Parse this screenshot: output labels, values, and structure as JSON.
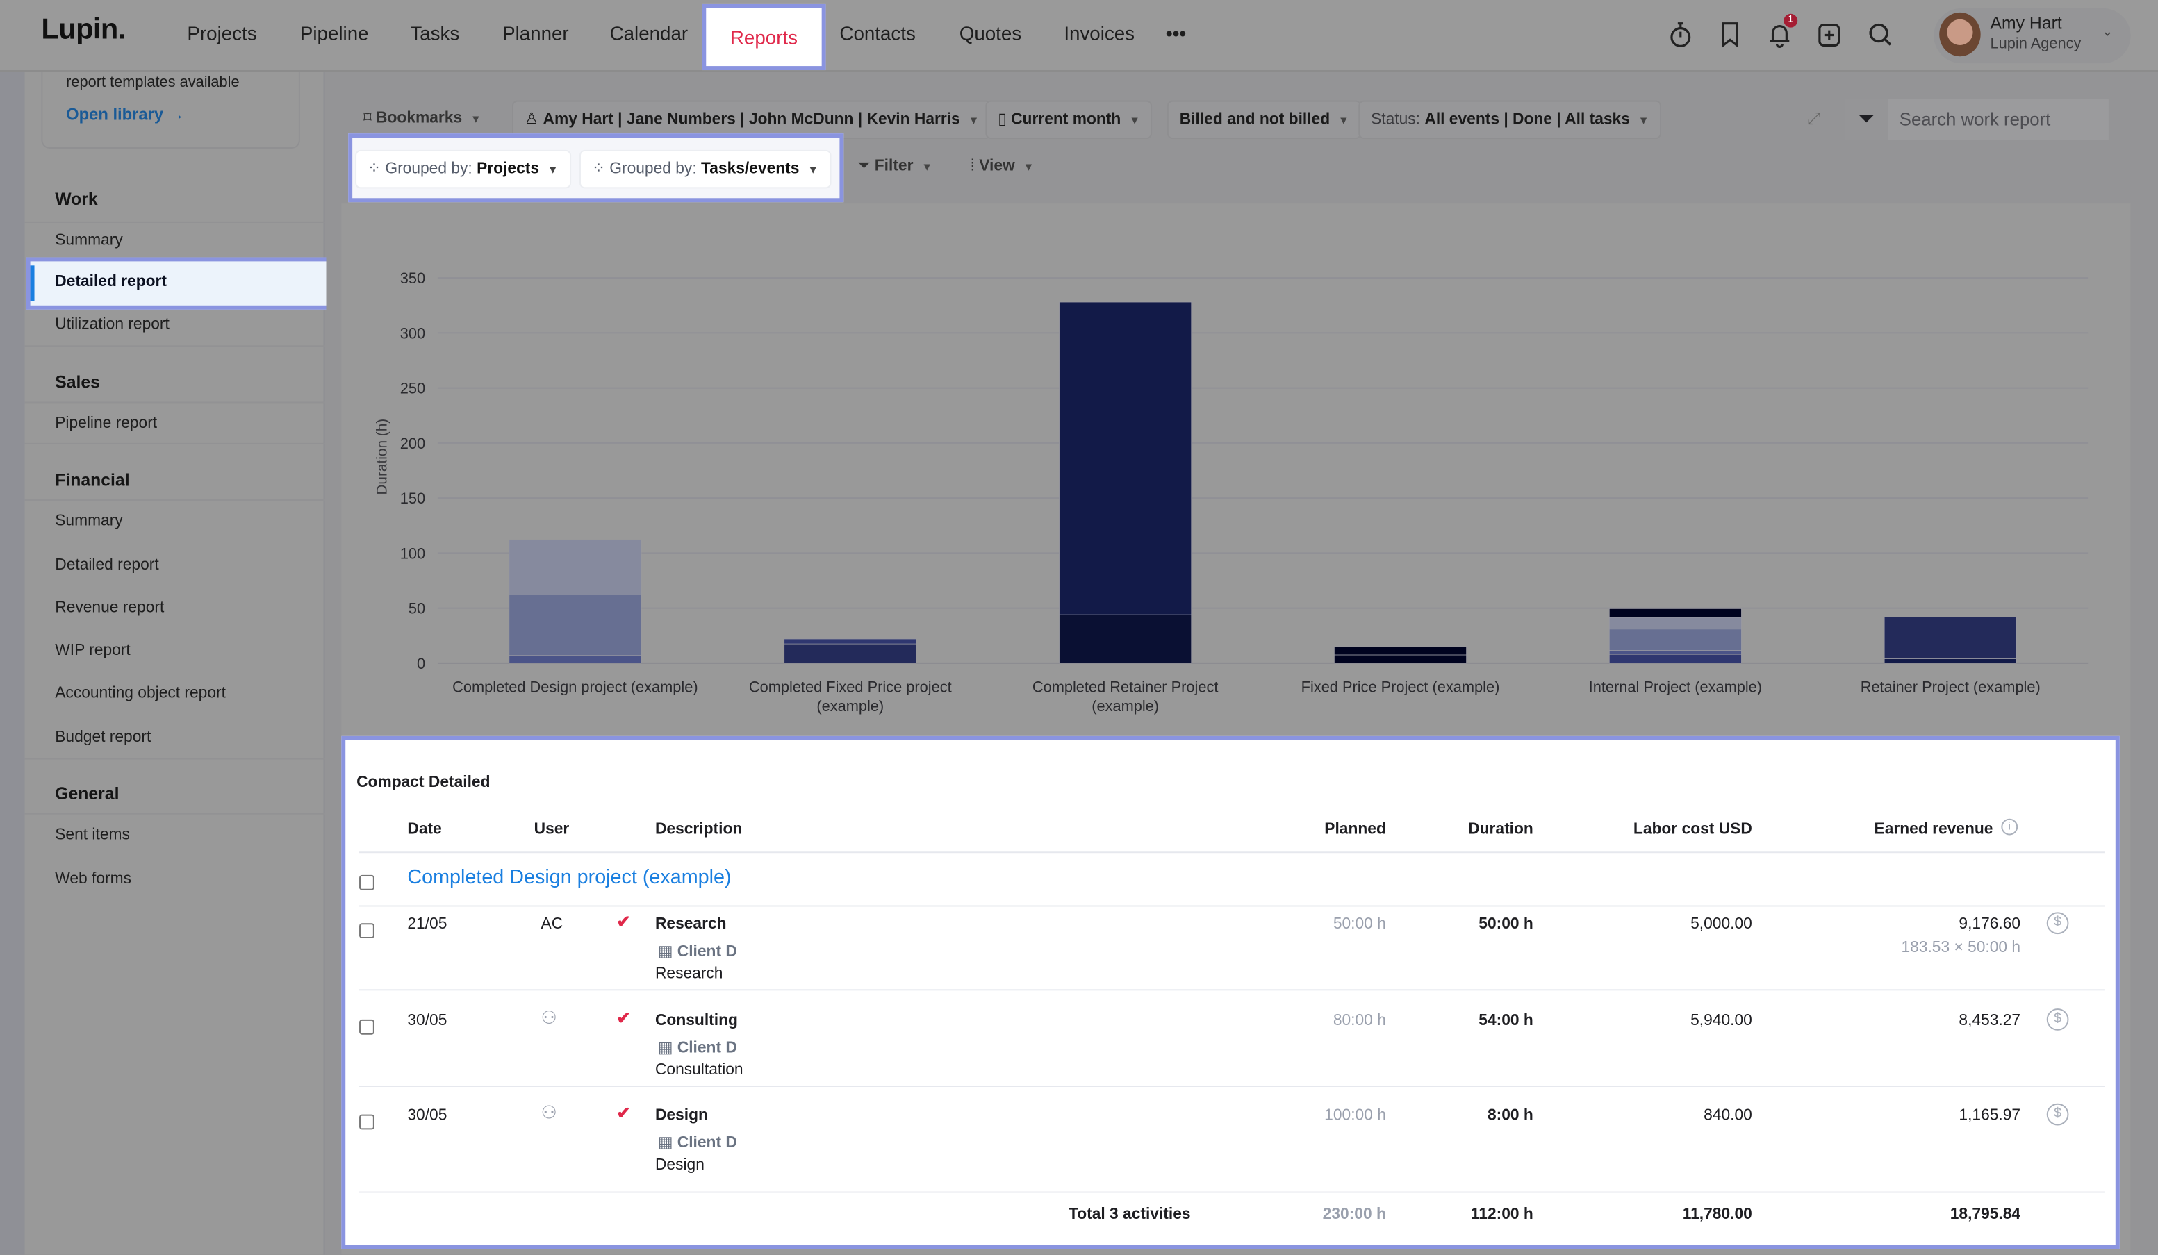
{
  "app": {
    "logo": "Lupin."
  },
  "nav": {
    "items": [
      "Projects",
      "Pipeline",
      "Tasks",
      "Planner",
      "Calendar",
      "Reports",
      "Contacts",
      "Quotes",
      "Invoices"
    ],
    "more": "•••",
    "active": "Reports",
    "notification_count": "1"
  },
  "profile": {
    "name": "Amy Hart",
    "org": "Lupin Agency"
  },
  "sidebar": {
    "library_text": "report templates available",
    "library_link": "Open library →",
    "sections": [
      {
        "title": "Work",
        "items": [
          "Summary",
          "Detailed report",
          "Utilization report"
        ]
      },
      {
        "title": "Sales",
        "items": [
          "Pipeline report"
        ]
      },
      {
        "title": "Financial",
        "items": [
          "Summary",
          "Detailed report",
          "Revenue report",
          "WIP report",
          "Accounting object report",
          "Budget report"
        ]
      },
      {
        "title": "General",
        "items": [
          "Sent items",
          "Web forms"
        ]
      }
    ],
    "active": "Detailed report"
  },
  "filters": {
    "bookmarks": "Bookmarks",
    "users": "Amy Hart | Jane Numbers | John McDunn | Kevin Harris",
    "period": "Current month",
    "billing": "Billed and not billed",
    "status_label": "Status:",
    "status_value": "All events | Done | All tasks",
    "search_placeholder": "Search work report",
    "group1_label": "Grouped by:",
    "group1_value": "Projects",
    "group2_label": "Grouped by:",
    "group2_value": "Tasks/events",
    "filter": "Filter",
    "view": "View"
  },
  "chart_data": {
    "type": "bar",
    "stacked": true,
    "ylabel": "Duration (h)",
    "ylim": [
      0,
      350
    ],
    "yticks": [
      0,
      50,
      100,
      150,
      200,
      250,
      300,
      350
    ],
    "grid": true,
    "categories": [
      "Completed Design project (example)",
      "Completed Fixed Price project (example)",
      "Completed Retainer Project (example)",
      "Fixed Price Project (example)",
      "Internal Project (example)",
      "Retainer Project (example)"
    ],
    "stacks": [
      {
        "values": [
          7,
          55,
          50
        ],
        "colors": [
          "#4b5488",
          "#676f92",
          "#868a9e"
        ]
      },
      {
        "values": [
          17.5,
          4.5
        ],
        "colors": [
          "#232a5a",
          "#2f3770"
        ]
      },
      {
        "values": [
          44,
          284
        ],
        "colors": [
          "#0a1033",
          "#121a48"
        ]
      },
      {
        "values": [
          7.5,
          7.5
        ],
        "colors": [
          "#00031f",
          "#00031f"
        ]
      },
      {
        "values": [
          8,
          3.5,
          19.5,
          10.5,
          8
        ],
        "colors": [
          "#2f3770",
          "#4b5488",
          "#676f92",
          "#868a9e",
          "#00031f"
        ]
      },
      {
        "values": [
          4,
          38
        ],
        "colors": [
          "#121a48",
          "#232a5a"
        ]
      }
    ]
  },
  "table": {
    "title": "Compact Detailed",
    "columns": [
      "Date",
      "User",
      "Description",
      "Planned",
      "Duration",
      "Labor cost USD",
      "Earned revenue"
    ],
    "group": "Completed Design project (example)",
    "rows": [
      {
        "date": "21/05",
        "user": "AC",
        "task": "Research",
        "client": "Client D",
        "note": "Research",
        "planned": "50:00 h",
        "duration": "50:00 h",
        "labor": "5,000.00",
        "revenue": "9,176.60",
        "revenue_detail": "183.53 × 50:00 h"
      },
      {
        "date": "30/05",
        "user": "",
        "task": "Consulting",
        "client": "Client D",
        "note": "Consultation",
        "planned": "80:00 h",
        "duration": "54:00 h",
        "labor": "5,940.00",
        "revenue": "8,453.27"
      },
      {
        "date": "30/05",
        "user": "",
        "task": "Design",
        "client": "Client D",
        "note": "Design",
        "planned": "100:00 h",
        "duration": "8:00 h",
        "labor": "840.00",
        "revenue": "1,165.97"
      }
    ],
    "total": {
      "label": "Total 3 activities",
      "planned": "230:00 h",
      "duration": "112:00 h",
      "labor": "11,780.00",
      "revenue": "18,795.84"
    }
  },
  "colors": {
    "accent": "#8a94e0",
    "reports_active": "#e0284a",
    "link": "#1a7fe0"
  }
}
